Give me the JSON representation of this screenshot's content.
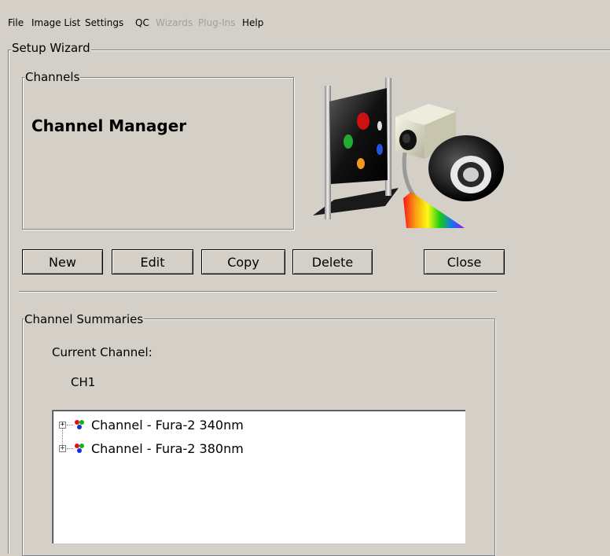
{
  "menu": [
    {
      "label": "File",
      "enabled": true
    },
    {
      "label": "Image List",
      "enabled": true
    },
    {
      "label": "Settings",
      "enabled": true
    },
    {
      "label": "QC",
      "enabled": true
    },
    {
      "label": "Wizards",
      "enabled": false
    },
    {
      "label": "Plug-Ins",
      "enabled": false
    },
    {
      "label": "Help",
      "enabled": true
    }
  ],
  "wizard": {
    "title": "Setup Wizard",
    "channels_group": "Channels",
    "heading": "Channel Manager",
    "illustration_icon": "channel-setup-illustration-icon"
  },
  "buttons": {
    "new": "New",
    "edit": "Edit",
    "copy": "Copy",
    "delete": "Delete",
    "close": "Close"
  },
  "summaries": {
    "group": "Channel Summaries",
    "current_label": "Current Channel:",
    "current_value": "CH1",
    "tree": [
      {
        "label": "Channel - Fura-2 340nm",
        "expander": "+",
        "icon": "channel-rgb-dots-icon"
      },
      {
        "label": "Channel - Fura-2 380nm",
        "expander": "+",
        "icon": "channel-rgb-dots-icon"
      }
    ]
  },
  "colors": {
    "window_bg": "#d4d0c8",
    "disabled_text": "#a0a0a0"
  }
}
